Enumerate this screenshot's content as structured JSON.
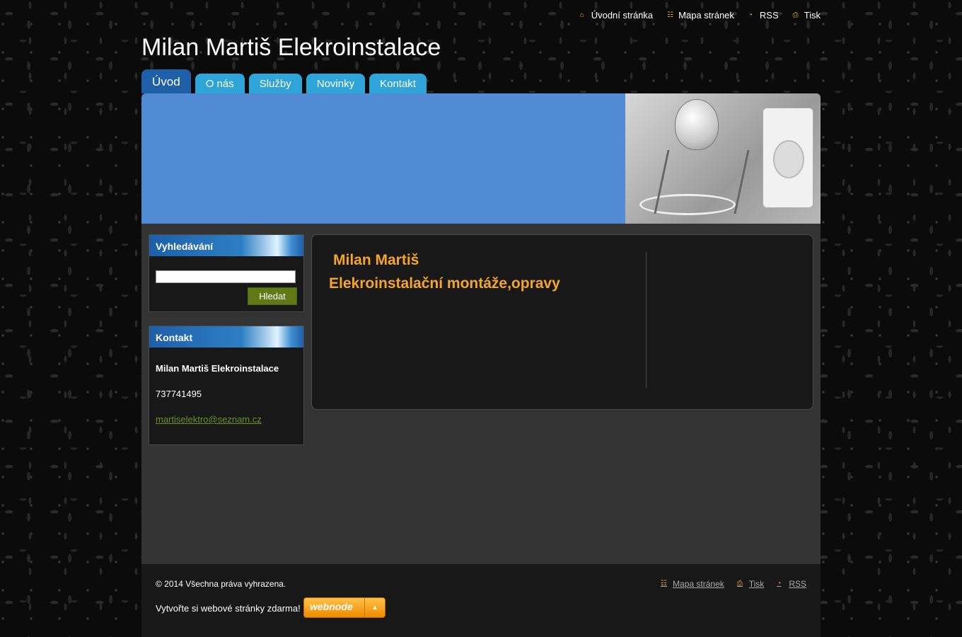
{
  "header": {
    "site_title": "Milan Martiš Elekroinstalace",
    "top_links": [
      {
        "label": "Úvodní stránka",
        "icon": "home-icon"
      },
      {
        "label": "Mapa stránek",
        "icon": "sitemap-icon"
      },
      {
        "label": "RSS",
        "icon": "rss-icon"
      },
      {
        "label": "Tisk",
        "icon": "print-icon"
      }
    ]
  },
  "nav": {
    "tabs": [
      {
        "label": "Úvod",
        "active": true
      },
      {
        "label": "O nás"
      },
      {
        "label": "Služby"
      },
      {
        "label": "Novinky"
      },
      {
        "label": "Kontakt"
      }
    ]
  },
  "sidebar": {
    "search": {
      "title": "Vyhledávání",
      "value": "",
      "button": "Hledat"
    },
    "contact": {
      "title": "Kontakt",
      "name": "Milan Martiš Elekroinstalace",
      "phone": "737741495",
      "email": "martiselektro@seznam.cz"
    }
  },
  "main": {
    "heading": "Milan Martiš",
    "subheading": "Elekroinstalační montáže,opravy"
  },
  "footer": {
    "copyright": "© 2014 Všechna práva vyhrazena.",
    "create_text": "Vytvořte si webové stránky zdarma!",
    "webnode_logo": "webnode",
    "links": [
      {
        "label": "Mapa stránek",
        "icon": "sitemap-icon"
      },
      {
        "label": "Tisk",
        "icon": "print-icon"
      },
      {
        "label": "RSS",
        "icon": "rss-icon"
      }
    ]
  },
  "colors": {
    "accent_orange": "#f5a623",
    "tab_blue": "#2ea4d8",
    "tab_active": "#1f5fa8",
    "banner_blue": "#518bd4",
    "search_button_green": "#5f7a16"
  }
}
